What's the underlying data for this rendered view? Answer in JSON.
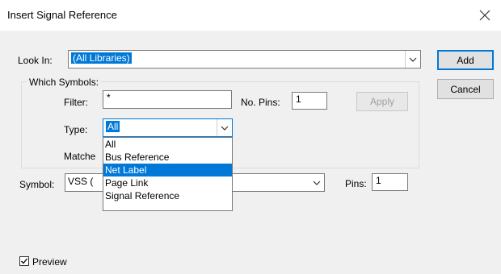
{
  "window": {
    "title": "Insert Signal Reference"
  },
  "look_in": {
    "label": "Look In:",
    "value": "(All Libraries)"
  },
  "which_symbols": {
    "title": "Which Symbols:"
  },
  "filter": {
    "label": "Filter:",
    "value": "*"
  },
  "no_pins": {
    "label": "No. Pins:",
    "value": "1"
  },
  "apply_button": {
    "label": "Apply"
  },
  "type": {
    "label": "Type:",
    "value": "All",
    "options": [
      "All",
      "Bus Reference",
      "Net Label",
      "Page Link",
      "Signal Reference"
    ],
    "highlighted": "Net Label"
  },
  "matches": {
    "label": "Matche"
  },
  "symbol": {
    "label": "Symbol:",
    "value": "VSS ("
  },
  "pins": {
    "label": "Pins:",
    "value": "1"
  },
  "buttons": {
    "add": "Add",
    "cancel": "Cancel"
  },
  "preview": {
    "label": "Preview",
    "checked": true
  },
  "colors": {
    "accent": "#0078d7",
    "background": "#f0f0f0"
  }
}
